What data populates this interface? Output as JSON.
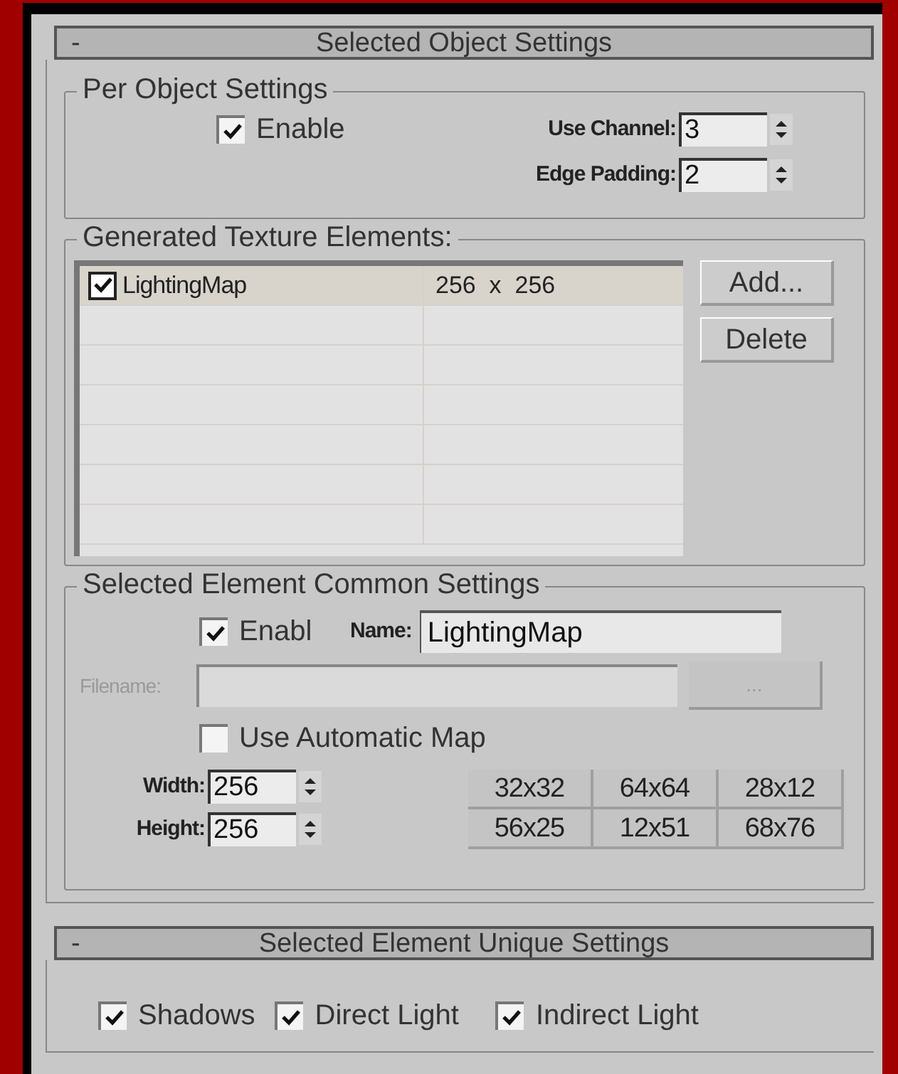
{
  "object_rollout": {
    "toggle": "-",
    "title": "Selected Object Settings",
    "per_object": {
      "title": "Per Object Settings",
      "enable": {
        "label": "Enable",
        "checked": true
      },
      "use_channel": {
        "label": "Use Channel:",
        "value": "3"
      },
      "edge_padding": {
        "label": "Edge Padding:",
        "value": "2"
      }
    },
    "elements": {
      "title": "Generated Texture Elements:",
      "rows": [
        {
          "checked": true,
          "name": "LightingMap",
          "size": "256  x  256",
          "selected": true
        }
      ],
      "buttons": [
        "Add...",
        "Delete"
      ]
    },
    "common": {
      "title": "Selected Element Common Settings",
      "enable": {
        "label": "Enabl",
        "checked": true
      },
      "name": {
        "label": "Name:",
        "value": "LightingMap"
      },
      "filename": {
        "label": "Filename:",
        "disabled": true
      },
      "browse": {
        "label": "...",
        "disabled": true
      },
      "auto_map": {
        "label": "Use Automatic Map",
        "checked": false
      },
      "width": {
        "label": "Width:",
        "value": "256"
      },
      "height": {
        "label": "Height:",
        "value": "256"
      },
      "presets": [
        {
          "label": "32x32"
        },
        {
          "label": "64x64"
        },
        {
          "label": "28x12"
        },
        {
          "label": "56x25"
        },
        {
          "label": "12x51"
        },
        {
          "label": "68x76"
        }
      ]
    }
  },
  "unique_rollout": {
    "toggle": "-",
    "title": "Selected Element Unique Settings",
    "options": [
      {
        "label": "Shadows",
        "checked": true
      },
      {
        "label": "Direct Light",
        "checked": true
      },
      {
        "label": "Indirect Light",
        "checked": true
      }
    ]
  }
}
